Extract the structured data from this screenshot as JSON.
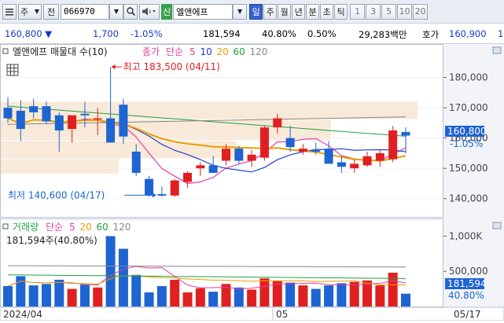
{
  "toolbar": {
    "market": "주",
    "jeon_label": "전",
    "code": "066970",
    "search_icon": "magnifier-icon",
    "sound_icon": "speaker-icon",
    "credit_badge": "신",
    "stock_name": "엘앤에프",
    "periods": [
      {
        "label": "일",
        "active": true
      },
      {
        "label": "주",
        "active": false
      },
      {
        "label": "월",
        "active": false
      },
      {
        "label": "년",
        "active": false
      },
      {
        "label": "분",
        "active": false
      },
      {
        "label": "초",
        "active": false
      },
      {
        "label": "틱",
        "active": false
      }
    ],
    "intervals": [
      "1",
      "3",
      "5",
      "10",
      "20"
    ]
  },
  "quote": {
    "price": "160,800",
    "change": "1,700",
    "change_pct": "-1.05%",
    "volume": "181,594",
    "volume_ratio": "40.80%",
    "turnover_ratio": "0.50%",
    "amount": "29,283백만",
    "bid_label": "호가",
    "bid_price": "160,900",
    "bid_extra": "1"
  },
  "price_panel": {
    "title": "엘앤에프 매물대 수(10)",
    "legend": [
      {
        "label": "종가",
        "color": "#e040a0"
      },
      {
        "label": "단순",
        "color": "#e040a0"
      },
      {
        "label": "5",
        "color": "#e040a0"
      },
      {
        "label": "10",
        "color": "#2040d0"
      },
      {
        "label": "20",
        "color": "#e8a000"
      },
      {
        "label": "60",
        "color": "#20a040"
      },
      {
        "label": "120",
        "color": "#888888"
      }
    ],
    "high_annotation": "최고 183,500 (04/11)",
    "low_annotation": "최저 140,600 (04/17)",
    "axis_ticks": [
      "180,000",
      "170,000",
      "160,000",
      "150,000",
      "140,000"
    ],
    "current_price_label": "160,800",
    "current_change_label": "-1.05%"
  },
  "volume_panel": {
    "legend": [
      {
        "label": "거래량",
        "color": "#20a040"
      },
      {
        "label": "단순",
        "color": "#e040a0"
      },
      {
        "label": "5",
        "color": "#e040a0"
      },
      {
        "label": "20",
        "color": "#e8a000"
      },
      {
        "label": "60",
        "color": "#20a040"
      },
      {
        "label": "120",
        "color": "#888888"
      }
    ],
    "value_label": "181,594주(40.80%)",
    "axis_ticks": [
      "1,000K",
      "500,000"
    ],
    "current_volume_label": "181,594",
    "current_ratio_label": "40.80%"
  },
  "date_axis": {
    "labels": [
      "2024/04",
      "05"
    ],
    "right_label": "05/17"
  },
  "colors": {
    "up": "#e02020",
    "down": "#1e64d2",
    "ma5": "#e040a0",
    "ma10": "#2040d0",
    "ma20": "#e8a000",
    "ma60": "#20a040",
    "ma120": "#888888"
  },
  "chart_data": {
    "type": "candlestick",
    "ylim": [
      135000,
      190000
    ],
    "candles": [
      {
        "o": 170000,
        "h": 173500,
        "l": 165000,
        "c": 166500
      },
      {
        "o": 169000,
        "h": 172500,
        "l": 159000,
        "c": 163000
      },
      {
        "o": 170500,
        "h": 173000,
        "l": 166500,
        "c": 168500
      },
      {
        "o": 170500,
        "h": 172000,
        "l": 164500,
        "c": 165500
      },
      {
        "o": 167500,
        "h": 168500,
        "l": 155500,
        "c": 162500
      },
      {
        "o": 163000,
        "h": 166500,
        "l": 158500,
        "c": 167500
      },
      {
        "o": 168000,
        "h": 172000,
        "l": 163500,
        "c": 167500
      },
      {
        "o": 166500,
        "h": 170000,
        "l": 161000,
        "c": 166500
      },
      {
        "o": 166500,
        "h": 183500,
        "l": 161500,
        "c": 158500
      },
      {
        "o": 171000,
        "h": 173000,
        "l": 158000,
        "c": 160500
      },
      {
        "o": 155500,
        "h": 158000,
        "l": 147500,
        "c": 148500
      },
      {
        "o": 146500,
        "h": 147500,
        "l": 140600,
        "c": 141000
      },
      {
        "o": 141500,
        "h": 144000,
        "l": 140600,
        "c": 141000
      },
      {
        "o": 141000,
        "h": 146500,
        "l": 140600,
        "c": 146000
      },
      {
        "o": 145500,
        "h": 149000,
        "l": 143500,
        "c": 148500
      },
      {
        "o": 150000,
        "h": 152000,
        "l": 147500,
        "c": 151000
      },
      {
        "o": 151000,
        "h": 154000,
        "l": 148500,
        "c": 148500
      },
      {
        "o": 152500,
        "h": 158000,
        "l": 151000,
        "c": 156500
      },
      {
        "o": 156500,
        "h": 157500,
        "l": 151500,
        "c": 152500
      },
      {
        "o": 152500,
        "h": 156000,
        "l": 150500,
        "c": 154500
      },
      {
        "o": 153500,
        "h": 164000,
        "l": 152500,
        "c": 163500
      },
      {
        "o": 163500,
        "h": 168000,
        "l": 161500,
        "c": 166500
      },
      {
        "o": 160000,
        "h": 164000,
        "l": 155500,
        "c": 157000
      },
      {
        "o": 155500,
        "h": 158000,
        "l": 154500,
        "c": 156500
      },
      {
        "o": 156000,
        "h": 158500,
        "l": 154500,
        "c": 155500
      },
      {
        "o": 156500,
        "h": 159000,
        "l": 151500,
        "c": 151500
      },
      {
        "o": 152000,
        "h": 154000,
        "l": 148500,
        "c": 150500
      },
      {
        "o": 150000,
        "h": 153000,
        "l": 148500,
        "c": 151500
      },
      {
        "o": 151000,
        "h": 155500,
        "l": 150500,
        "c": 154000
      },
      {
        "o": 152500,
        "h": 156000,
        "l": 150500,
        "c": 155000
      },
      {
        "o": 153000,
        "h": 164000,
        "l": 152000,
        "c": 162500
      },
      {
        "o": 162000,
        "h": 163500,
        "l": 155000,
        "c": 160800
      }
    ],
    "volumes": [
      290000,
      430000,
      300000,
      320000,
      380000,
      250000,
      310000,
      270000,
      1000000,
      820000,
      450000,
      200000,
      290000,
      380000,
      200000,
      260000,
      210000,
      320000,
      270000,
      240000,
      400000,
      370000,
      340000,
      300000,
      250000,
      300000,
      330000,
      350000,
      370000,
      300000,
      480000,
      181594
    ]
  }
}
